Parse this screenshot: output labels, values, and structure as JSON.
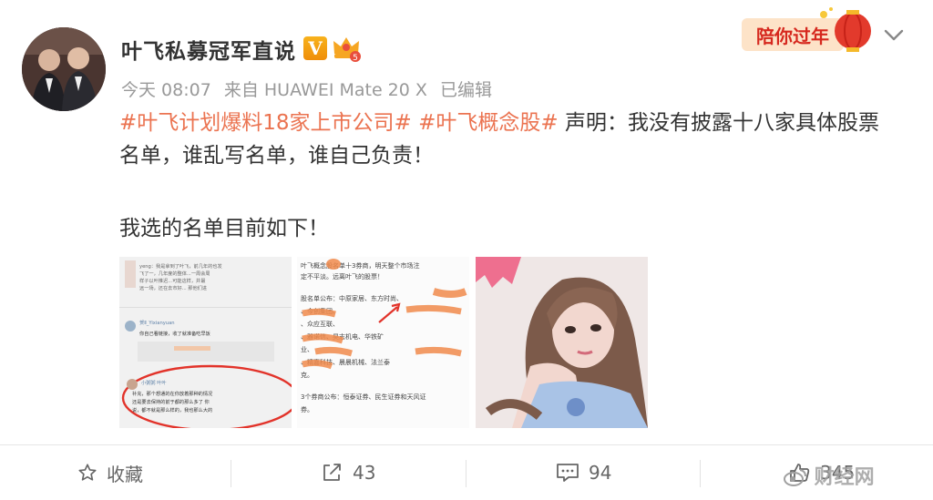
{
  "post": {
    "author": "叶飞私募冠军直说",
    "verified_badge": "V",
    "time": "今天 08:07",
    "source": "来自 HUAWEI Mate 20 X",
    "edited": "已编辑",
    "topic1": "#叶飞计划爆料18家上市公司#",
    "topic2": "#叶飞概念股#",
    "text_line1_rest": " 声明：我没有披露十八家具体股票",
    "text_line2": "名单，谁乱写名单，谁自己负责！",
    "text_line3": "我选的名单目前如下！"
  },
  "banner": {
    "text": "陪你过年"
  },
  "images": {
    "img1": {
      "lines": [
        "yeng：我是拿到了叶飞，前几年的也发",
        "飞了一，几年度的整体...一周会周",
        "样子以叶推迟...可能这样，并最",
        "远一场，还在去市好... 那他们进"
      ],
      "reply_user": "贺Ⅱ_Yixianyuan",
      "reply_text": "你自己看链接，收了就准备吃早饭",
      "boxed_user": "小粥粥 叶叶",
      "boxed_lines": [
        "补充，那个想通的在你放着那种的情况",
        "还是要去保持的前于都的那么多了 你",
        "说，都不就是那么样的，我也那么大的"
      ]
    },
    "img2": {
      "lines": [
        "叶飞概念股名单十3券商，明天整个市场注",
        "定不平淡。远离叶飞的股票！",
        "",
        "股名单公布：中原家居、东方时尚、",
        "、今创集团、",
        "、众应互联、",
        "、雅诺信、昊志机电、华铁矿",
        "业、",
        "、精嘉科技、晨晨机械、法兰泰",
        "克。",
        "",
        "3个券商公布：恒泰证券、民生证券和天风证",
        "券。"
      ]
    },
    "img3": {
      "desc_text": ""
    }
  },
  "actions": {
    "favorite": "收藏",
    "repost": "43",
    "comment": "94",
    "like": "345"
  },
  "watermark": "财经网",
  "colors": {
    "topic": "#eb7350",
    "meta": "#999999",
    "text": "#333333",
    "badge": "#f39c12"
  }
}
